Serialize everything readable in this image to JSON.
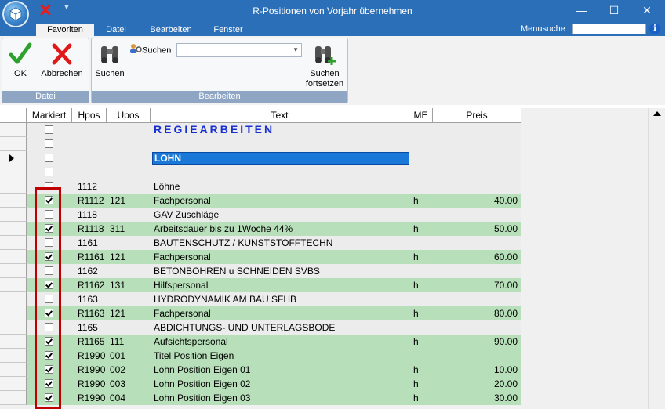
{
  "window": {
    "title": "R-Positionen von Vorjahr übernehmen",
    "minimize_glyph": "—",
    "maximize_glyph": "☐",
    "close_glyph": "✕"
  },
  "menu": {
    "tabs": [
      "Favoriten",
      "Datei",
      "Bearbeiten",
      "Fenster"
    ],
    "active_tab": "Favoriten",
    "menusuche_label": "Menusuche",
    "menusuche_value": "",
    "info_glyph": "i"
  },
  "ribbon": {
    "ok_label": "OK",
    "abbrechen_label": "Abbrechen",
    "group_datei": "Datei",
    "suchen_label": "Suchen",
    "suchen_combo_label": "Suchen",
    "suchen_combo_value": "",
    "suchen_fortsetzen_line1": "Suchen",
    "suchen_fortsetzen_line2": "fortsetzen",
    "group_bearbeiten": "Bearbeiten"
  },
  "grid": {
    "columns": [
      "Markiert",
      "Hpos",
      "Upos",
      "Text",
      "ME",
      "Preis"
    ],
    "rows": [
      {
        "checked": false,
        "hpos": "",
        "upos": "",
        "text": "REGIEARBEITEN",
        "me": "",
        "preis": "",
        "style": "title"
      },
      {
        "checked": false,
        "hpos": "",
        "upos": "",
        "text": "",
        "me": "",
        "preis": "",
        "style": "plain"
      },
      {
        "checked": false,
        "hpos": "",
        "upos": "",
        "text": "LOHN",
        "me": "",
        "preis": "",
        "style": "editing",
        "current": true
      },
      {
        "checked": false,
        "hpos": "",
        "upos": "",
        "text": "",
        "me": "",
        "preis": "",
        "style": "plain"
      },
      {
        "checked": false,
        "hpos": "1112",
        "upos": "",
        "text": "Löhne",
        "me": "",
        "preis": "",
        "style": "plain"
      },
      {
        "checked": true,
        "hpos": "R1112",
        "upos": "121",
        "text": "Fachpersonal",
        "me": "h",
        "preis": "40.00",
        "style": "green"
      },
      {
        "checked": false,
        "hpos": "1118",
        "upos": "",
        "text": "GAV Zuschläge",
        "me": "",
        "preis": "",
        "style": "plain"
      },
      {
        "checked": true,
        "hpos": "R1118",
        "upos": "311",
        "text": "Arbeitsdauer bis zu 1Woche 44%",
        "me": "h",
        "preis": "50.00",
        "style": "green"
      },
      {
        "checked": false,
        "hpos": "1161",
        "upos": "",
        "text": "BAUTENSCHUTZ / KUNSTSTOFFTECHN",
        "me": "",
        "preis": "",
        "style": "plain"
      },
      {
        "checked": true,
        "hpos": "R1161",
        "upos": "121",
        "text": "Fachpersonal",
        "me": "h",
        "preis": "60.00",
        "style": "green"
      },
      {
        "checked": false,
        "hpos": "1162",
        "upos": "",
        "text": "BETONBOHREN u SCHNEIDEN  SVBS",
        "me": "",
        "preis": "",
        "style": "plain"
      },
      {
        "checked": true,
        "hpos": "R1162",
        "upos": "131",
        "text": "Hilfspersonal",
        "me": "h",
        "preis": "70.00",
        "style": "green"
      },
      {
        "checked": false,
        "hpos": "1163",
        "upos": "",
        "text": "HYDRODYNAMIK AM BAU  SFHB",
        "me": "",
        "preis": "",
        "style": "plain"
      },
      {
        "checked": true,
        "hpos": "R1163",
        "upos": "121",
        "text": "Fachpersonal",
        "me": "h",
        "preis": "80.00",
        "style": "green"
      },
      {
        "checked": false,
        "hpos": "1165",
        "upos": "",
        "text": "ABDICHTUNGS- UND UNTERLAGSBODE",
        "me": "",
        "preis": "",
        "style": "plain"
      },
      {
        "checked": true,
        "hpos": "R1165",
        "upos": "111",
        "text": "Aufsichtspersonal",
        "me": "h",
        "preis": "90.00",
        "style": "green"
      },
      {
        "checked": true,
        "hpos": "R1990",
        "upos": "001",
        "text": "Titel Position Eigen",
        "me": "",
        "preis": "",
        "style": "green"
      },
      {
        "checked": true,
        "hpos": "R1990",
        "upos": "002",
        "text": "Lohn Position Eigen 01",
        "me": "h",
        "preis": "10.00",
        "style": "green"
      },
      {
        "checked": true,
        "hpos": "R1990",
        "upos": "003",
        "text": "Lohn Position Eigen 02",
        "me": "h",
        "preis": "20.00",
        "style": "green"
      },
      {
        "checked": true,
        "hpos": "R1990",
        "upos": "004",
        "text": "Lohn Position Eigen 03",
        "me": "h",
        "preis": "30.00",
        "style": "green"
      }
    ]
  }
}
